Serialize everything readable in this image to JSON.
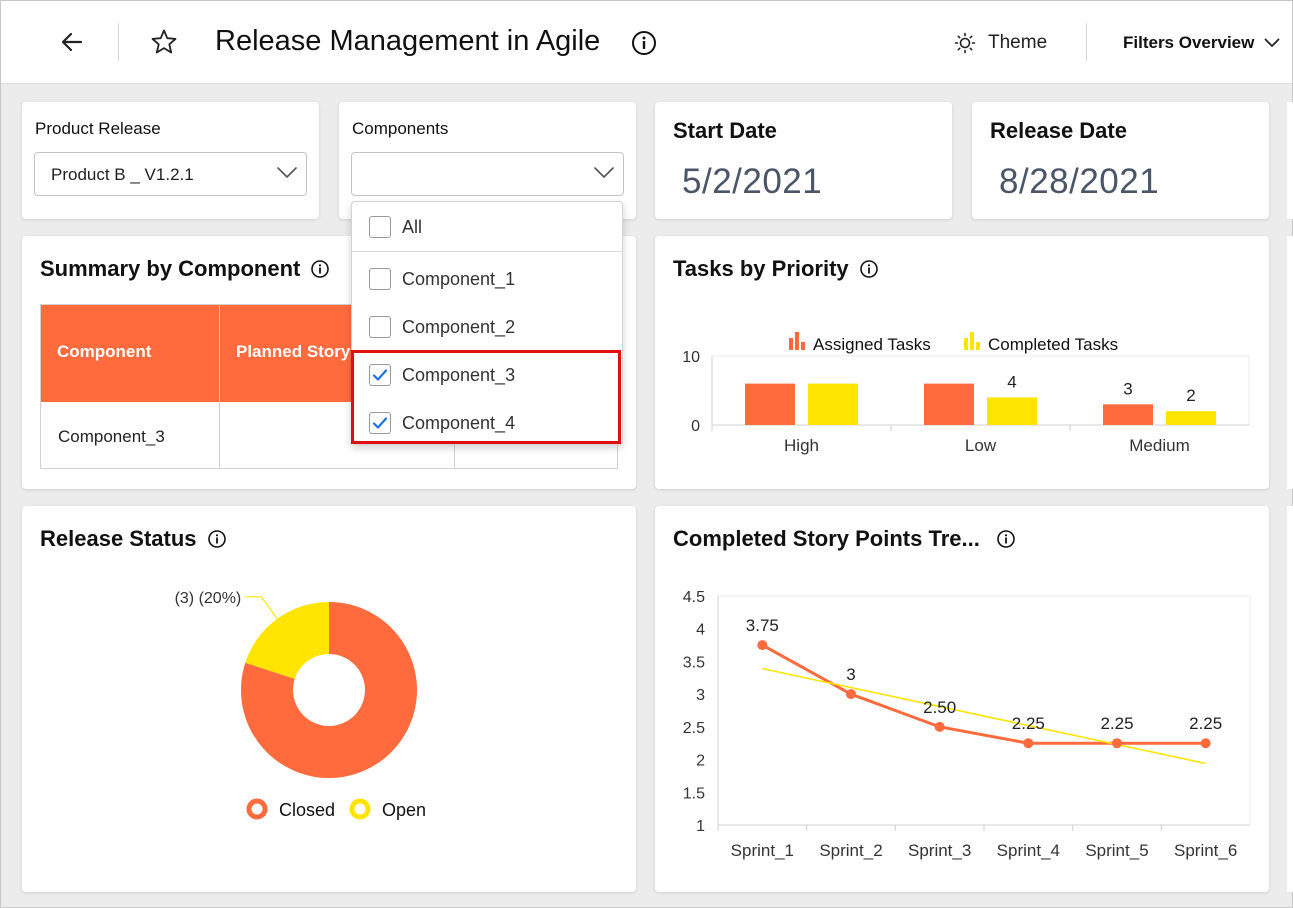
{
  "header": {
    "title": "Release Management in Agile",
    "theme_label": "Theme",
    "filters_label": "Filters Overview"
  },
  "filters": {
    "product_release": {
      "label": "Product Release",
      "value": "Product B _ V1.2.1"
    },
    "components": {
      "label": "Components",
      "value": "",
      "options": [
        {
          "label": "All",
          "checked": false
        },
        {
          "label": "Component_1",
          "checked": false
        },
        {
          "label": "Component_2",
          "checked": false
        },
        {
          "label": "Component_3",
          "checked": true
        },
        {
          "label": "Component_4",
          "checked": true
        }
      ]
    }
  },
  "dates": {
    "start": {
      "label": "Start Date",
      "value": "5/2/2021"
    },
    "release": {
      "label": "Release Date",
      "value": "8/28/2021"
    }
  },
  "summary": {
    "title": "Summary by Component",
    "columns": [
      "Component",
      "Planned Story"
    ],
    "rows": [
      [
        "Component_3"
      ]
    ]
  },
  "colors": {
    "accent": "#ff6b3d",
    "yellow": "#ffe400",
    "highlight": "#e01010",
    "check": "#1a73e8"
  },
  "tasks_chart_title": "Tasks by Priority",
  "status_chart_title": "Release Status",
  "trend_chart_title": "Completed Story Points Tre...",
  "chart_data": [
    {
      "type": "bar",
      "categories": [
        "High",
        "Low",
        "Medium"
      ],
      "series": [
        {
          "name": "Assigned Tasks",
          "values": [
            6,
            6,
            3
          ]
        },
        {
          "name": "Completed Tasks",
          "values": [
            6,
            4,
            2
          ]
        }
      ],
      "data_labels": [
        {
          "category": "Low",
          "series": "Completed Tasks",
          "text": "4"
        },
        {
          "category": "Medium",
          "series": "Assigned Tasks",
          "text": "3"
        },
        {
          "category": "Medium",
          "series": "Completed Tasks",
          "text": "2"
        }
      ],
      "y_ticks": [
        "10",
        "0"
      ],
      "ylim": [
        0,
        10
      ],
      "legend": "top"
    },
    {
      "type": "pie",
      "donut": true,
      "slices": [
        {
          "name": "Closed",
          "value": 80
        },
        {
          "name": "Open",
          "value": 20
        }
      ],
      "annotation": "(3) (20%)",
      "legend": "bottom"
    },
    {
      "type": "line",
      "x": [
        "Sprint_1",
        "Sprint_2",
        "Sprint_3",
        "Sprint_4",
        "Sprint_5",
        "Sprint_6"
      ],
      "series": [
        {
          "values": [
            3.75,
            3,
            2.5,
            2.25,
            2.25,
            2.25
          ],
          "labels": [
            "3.75",
            "3",
            "2.50",
            "2.25",
            "2.25",
            "2.25"
          ]
        }
      ],
      "trendline": [
        3.39,
        1.94
      ],
      "y_ticks": [
        "4.5",
        "4",
        "3.5",
        "3",
        "2.5",
        "2",
        "1.5",
        "1"
      ],
      "ylim": [
        1,
        4.5
      ]
    }
  ]
}
